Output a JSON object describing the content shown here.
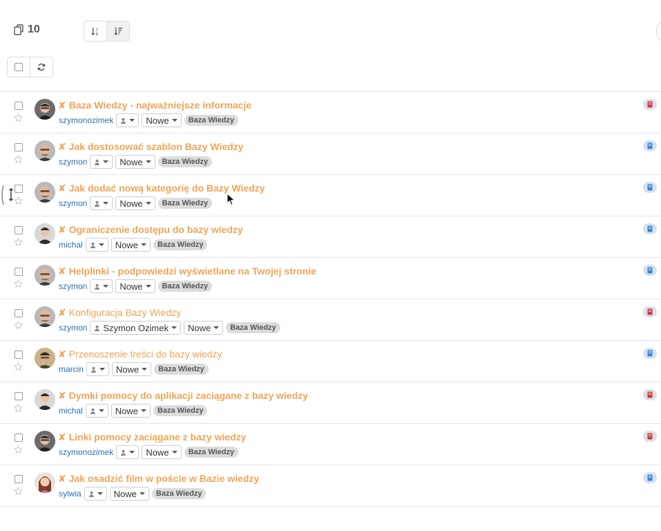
{
  "header": {
    "count": "10"
  },
  "items": [
    {
      "title": "Baza Wiedzy - najważniejsze informacje",
      "bold": true,
      "author": "szymonozimek",
      "assignee": "",
      "status": "Nowe",
      "tag": "Baza Wiedzy",
      "type_color": "#e03030",
      "avatar": "a"
    },
    {
      "title": "Jak dostosować szablon Bazy Wiedzy",
      "bold": true,
      "author": "szymon",
      "assignee": "",
      "status": "Nowe",
      "tag": "Baza Wiedzy",
      "type_color": "#3b83d6",
      "avatar": "b"
    },
    {
      "title": "Jak dodać nową kategorię do Bazy Wiedzy",
      "bold": true,
      "author": "szymon",
      "assignee": "",
      "status": "Nowe",
      "tag": "Baza Wiedzy",
      "type_color": "#3b83d6",
      "avatar": "b"
    },
    {
      "title": "Ograniczenie dostępu do bazy wiedzy",
      "bold": true,
      "author": "michal",
      "assignee": "",
      "status": "Nowe",
      "tag": "Baza Wiedzy",
      "type_color": "#3b83d6",
      "avatar": "c"
    },
    {
      "title": "Helplinki - podpowiedzi wyświetlane na Twojej stronie",
      "bold": true,
      "author": "szymon",
      "assignee": "",
      "status": "Nowe",
      "tag": "Baza Wiedzy",
      "type_color": "#3b83d6",
      "avatar": "b"
    },
    {
      "title": "Konfiguracja Bazy Wiedzy",
      "bold": false,
      "author": "szymon",
      "assignee": "Szymon Ozimek",
      "status": "Nowe",
      "tag": "Baza Wiedzy",
      "type_color": "#e03030",
      "avatar": "b"
    },
    {
      "title": "Przenoszenie treści do bazy wiedzy",
      "bold": false,
      "author": "marcin",
      "assignee": "",
      "status": "Nowe",
      "tag": "Baza Wiedzy",
      "type_color": "#3b83d6",
      "avatar": "d"
    },
    {
      "title": "Dymki pomocy do aplikacji zaciągane z bazy wiedzy",
      "bold": true,
      "author": "michal",
      "assignee": "",
      "status": "Nowe",
      "tag": "Baza Wiedzy",
      "type_color": "#e03030",
      "avatar": "c"
    },
    {
      "title": "Linki pomocy zaciągane z bazy wiedzy",
      "bold": true,
      "author": "szymonozimek",
      "assignee": "",
      "status": "Nowe",
      "tag": "Baza Wiedzy",
      "type_color": "#e03030",
      "avatar": "a"
    },
    {
      "title": "Jak osadzić film w poście w Bazie wiedzy",
      "bold": true,
      "author": "sylwia",
      "assignee": "",
      "status": "Nowe",
      "tag": "Baza Wiedzy",
      "type_color": "#3b83d6",
      "avatar": "e"
    }
  ],
  "colors": {
    "title": "#f0a456",
    "author": "#2a6fb0",
    "badge_bg": "#d6e2ee",
    "tag_bg": "#dcdcdc"
  }
}
